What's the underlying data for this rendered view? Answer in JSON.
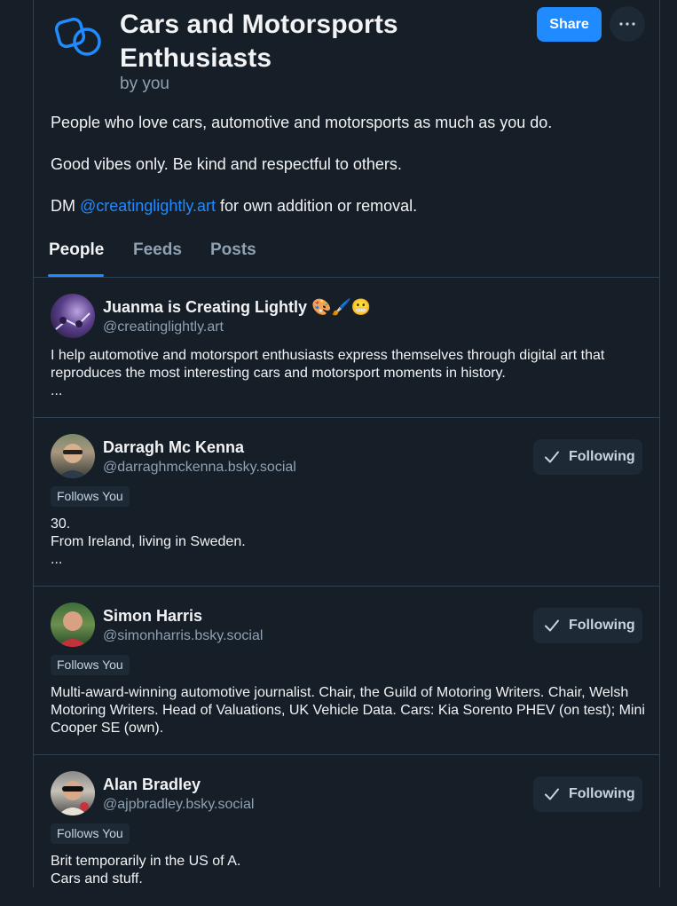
{
  "list": {
    "title": "Cars and Motorsports Enthusiasts",
    "byline": "by you",
    "share_label": "Share",
    "more_icon": "ellipsis-icon",
    "description": [
      "People who love cars, automotive and motorsports as much as you do.",
      "Good vibes only. Be kind and respectful to others."
    ],
    "dm_prefix": "DM ",
    "dm_link": "@creatinglightly.art",
    "dm_suffix": " for own addition or removal."
  },
  "tabs": [
    "People",
    "Feeds",
    "Posts"
  ],
  "colors": {
    "accent": "#208bfe",
    "background": "#161e27",
    "muted": "#8fa1b2"
  },
  "people": [
    {
      "name": "Juanma is Creating Lightly",
      "emoji": "🎨🖌️😬",
      "handle": "@creatinglightly.art",
      "bio": "I help automotive and motorsport enthusiasts express themselves through digital art that reproduces the most interesting cars and motorsport moments in history.\n..."
    },
    {
      "name": "Darragh Mc Kenna",
      "handle": "@darraghmckenna.bsky.social",
      "follows_you": "Follows You",
      "button": "Following",
      "bio": "30.\nFrom Ireland, living in Sweden.\n..."
    },
    {
      "name": "Simon Harris",
      "handle": "@simonharris.bsky.social",
      "follows_you": "Follows You",
      "button": "Following",
      "bio": "Multi-award-winning automotive journalist. Chair, the Guild of Motoring Writers. Chair, Welsh Motoring Writers. Head of Valuations, UK Vehicle Data. Cars: Kia Sorento PHEV (on test); Mini Cooper SE (own)."
    },
    {
      "name": "Alan Bradley",
      "handle": "@ajpbradley.bsky.social",
      "follows_you": "Follows You",
      "button": "Following",
      "bio": "Brit temporarily in the US of A.\nCars and stuff."
    }
  ]
}
